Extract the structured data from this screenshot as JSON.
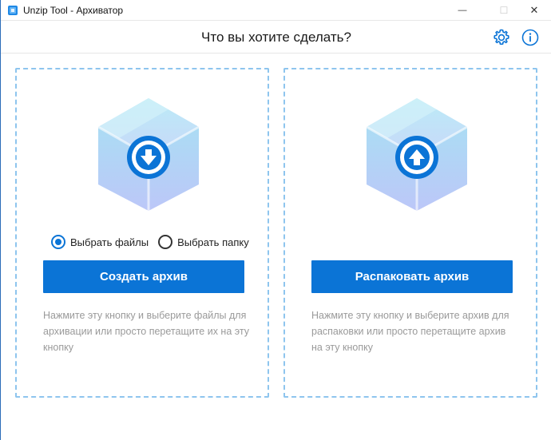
{
  "window": {
    "title": "Unzip Tool - Архиватор",
    "minimize_glyph": "—",
    "maximize_glyph": "☐",
    "close_glyph": "✕"
  },
  "header": {
    "title": "Что вы хотите сделать?",
    "icons": [
      "gear-icon",
      "info-icon"
    ]
  },
  "archive_panel": {
    "radio_options": [
      {
        "label": "Выбрать файлы",
        "checked": true
      },
      {
        "label": "Выбрать папку",
        "checked": false
      }
    ],
    "button_label": "Создать архив",
    "hint": "Нажмите эту кнопку и выберите файлы для архивации или просто перетащите их на эту кнопку",
    "icon": "download-cube-icon"
  },
  "extract_panel": {
    "button_label": "Распаковать архив",
    "hint": "Нажмите эту кнопку и выберите архив для распаковки или просто перетащите архив на эту кнопку",
    "icon": "upload-cube-icon"
  },
  "colors": {
    "accent": "#0b74d6",
    "panel_border": "#8ec5ee",
    "hint_text": "#9a9a9a",
    "cube_top": "#a6e3f3",
    "cube_bottom": "#bcc7f8"
  }
}
